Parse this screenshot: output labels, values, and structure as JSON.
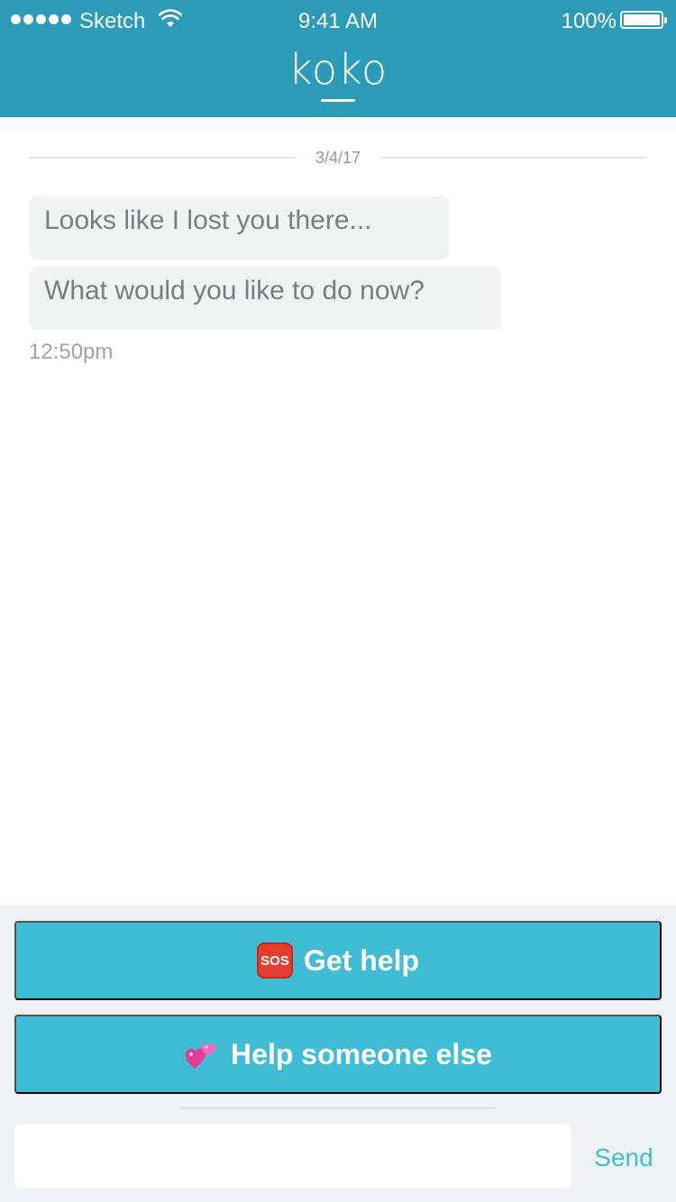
{
  "status_bar": {
    "carrier": "Sketch",
    "time": "9:41 AM",
    "battery_percent": "100%",
    "battery_level": 1.0,
    "signal_bars": 5
  },
  "header": {
    "logo": "koko",
    "background_color": "#2b9bb8"
  },
  "conversation": {
    "date": "3/4/17",
    "messages": [
      {
        "text": "Looks like I lost you there..."
      },
      {
        "text": "What would you like to do now?"
      }
    ],
    "timestamp": "12:50pm"
  },
  "actions": {
    "get_help": {
      "label": "Get help",
      "icon": "sos-icon",
      "icon_text": "SOS"
    },
    "help_someone": {
      "label": "Help someone else",
      "icon": "two-hearts-icon"
    },
    "button_color": "#40bdd4"
  },
  "composer": {
    "placeholder": "",
    "send_label": "Send"
  }
}
